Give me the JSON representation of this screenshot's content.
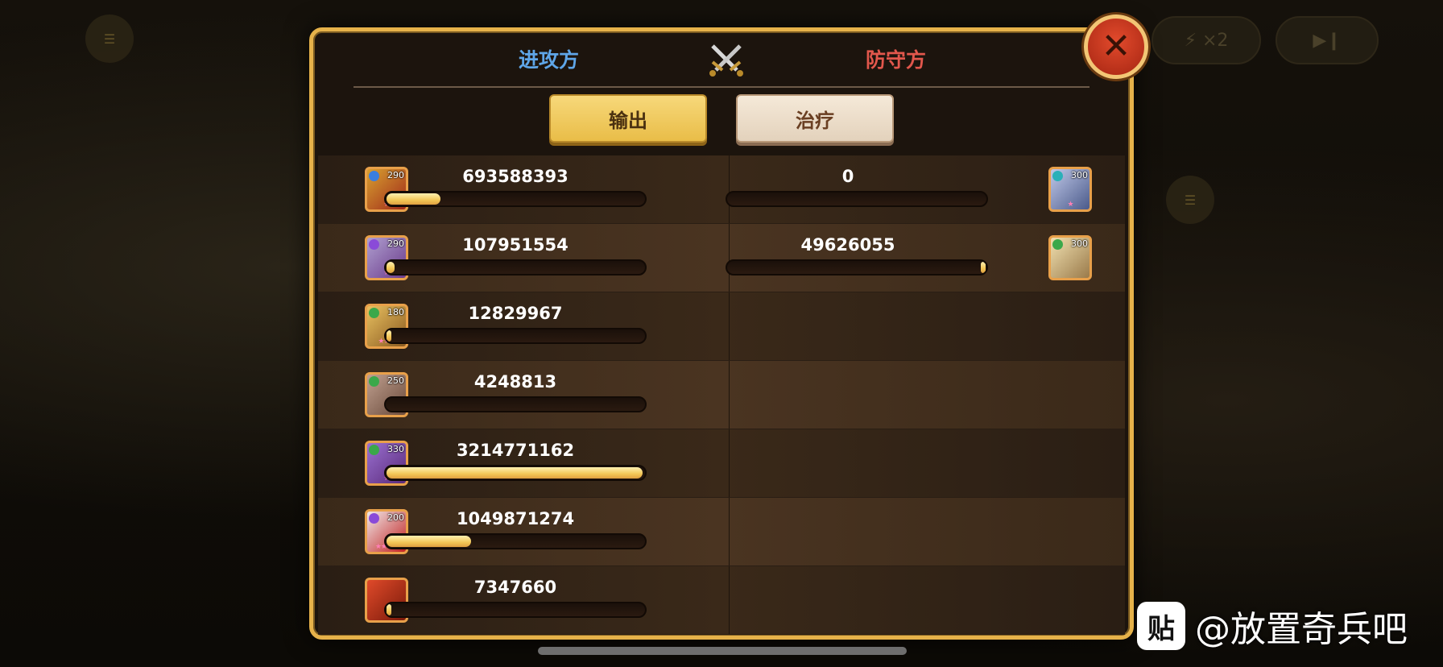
{
  "header": {
    "attacker_label": "进攻方",
    "defender_label": "防守方"
  },
  "tabs": {
    "output_label": "输出",
    "heal_label": "治疗",
    "active": "输出"
  },
  "attackers": [
    {
      "level": "290",
      "element": "blue",
      "value": "693588393",
      "fill": 0.21,
      "stars": "★"
    },
    {
      "level": "290",
      "element": "purple",
      "value": "107951554",
      "fill": 0.03,
      "stars": "★"
    },
    {
      "level": "180",
      "element": "green",
      "value": "12829967",
      "fill": 0.004,
      "stars": "★★★"
    },
    {
      "level": "250",
      "element": "green",
      "value": "4248813",
      "fill": 0.0,
      "stars": ""
    },
    {
      "level": "330",
      "element": "green",
      "value": "3214771162",
      "fill": 1.0,
      "stars": "★"
    },
    {
      "level": "200",
      "element": "purple",
      "value": "1049871274",
      "fill": 0.33,
      "stars": "★★★★"
    },
    {
      "level": "",
      "element": "",
      "value": "7347660",
      "fill": 0.004,
      "stars": ""
    }
  ],
  "defenders": [
    {
      "level": "300",
      "element": "teal",
      "value": "0",
      "fill": 0.0,
      "stars": "★"
    },
    {
      "level": "300",
      "element": "green",
      "value": "49626055",
      "fill": 0.02,
      "stars": ""
    }
  ],
  "watermark": {
    "logo_text": "贴",
    "text": "@放置奇兵吧"
  },
  "colors": {
    "attacker": "#5fa6e8",
    "defender": "#e2574c",
    "frame": "#e6b24a",
    "bar_fill": "#f2c656"
  },
  "icons": [
    "crossed-swords-icon",
    "close-icon"
  ]
}
